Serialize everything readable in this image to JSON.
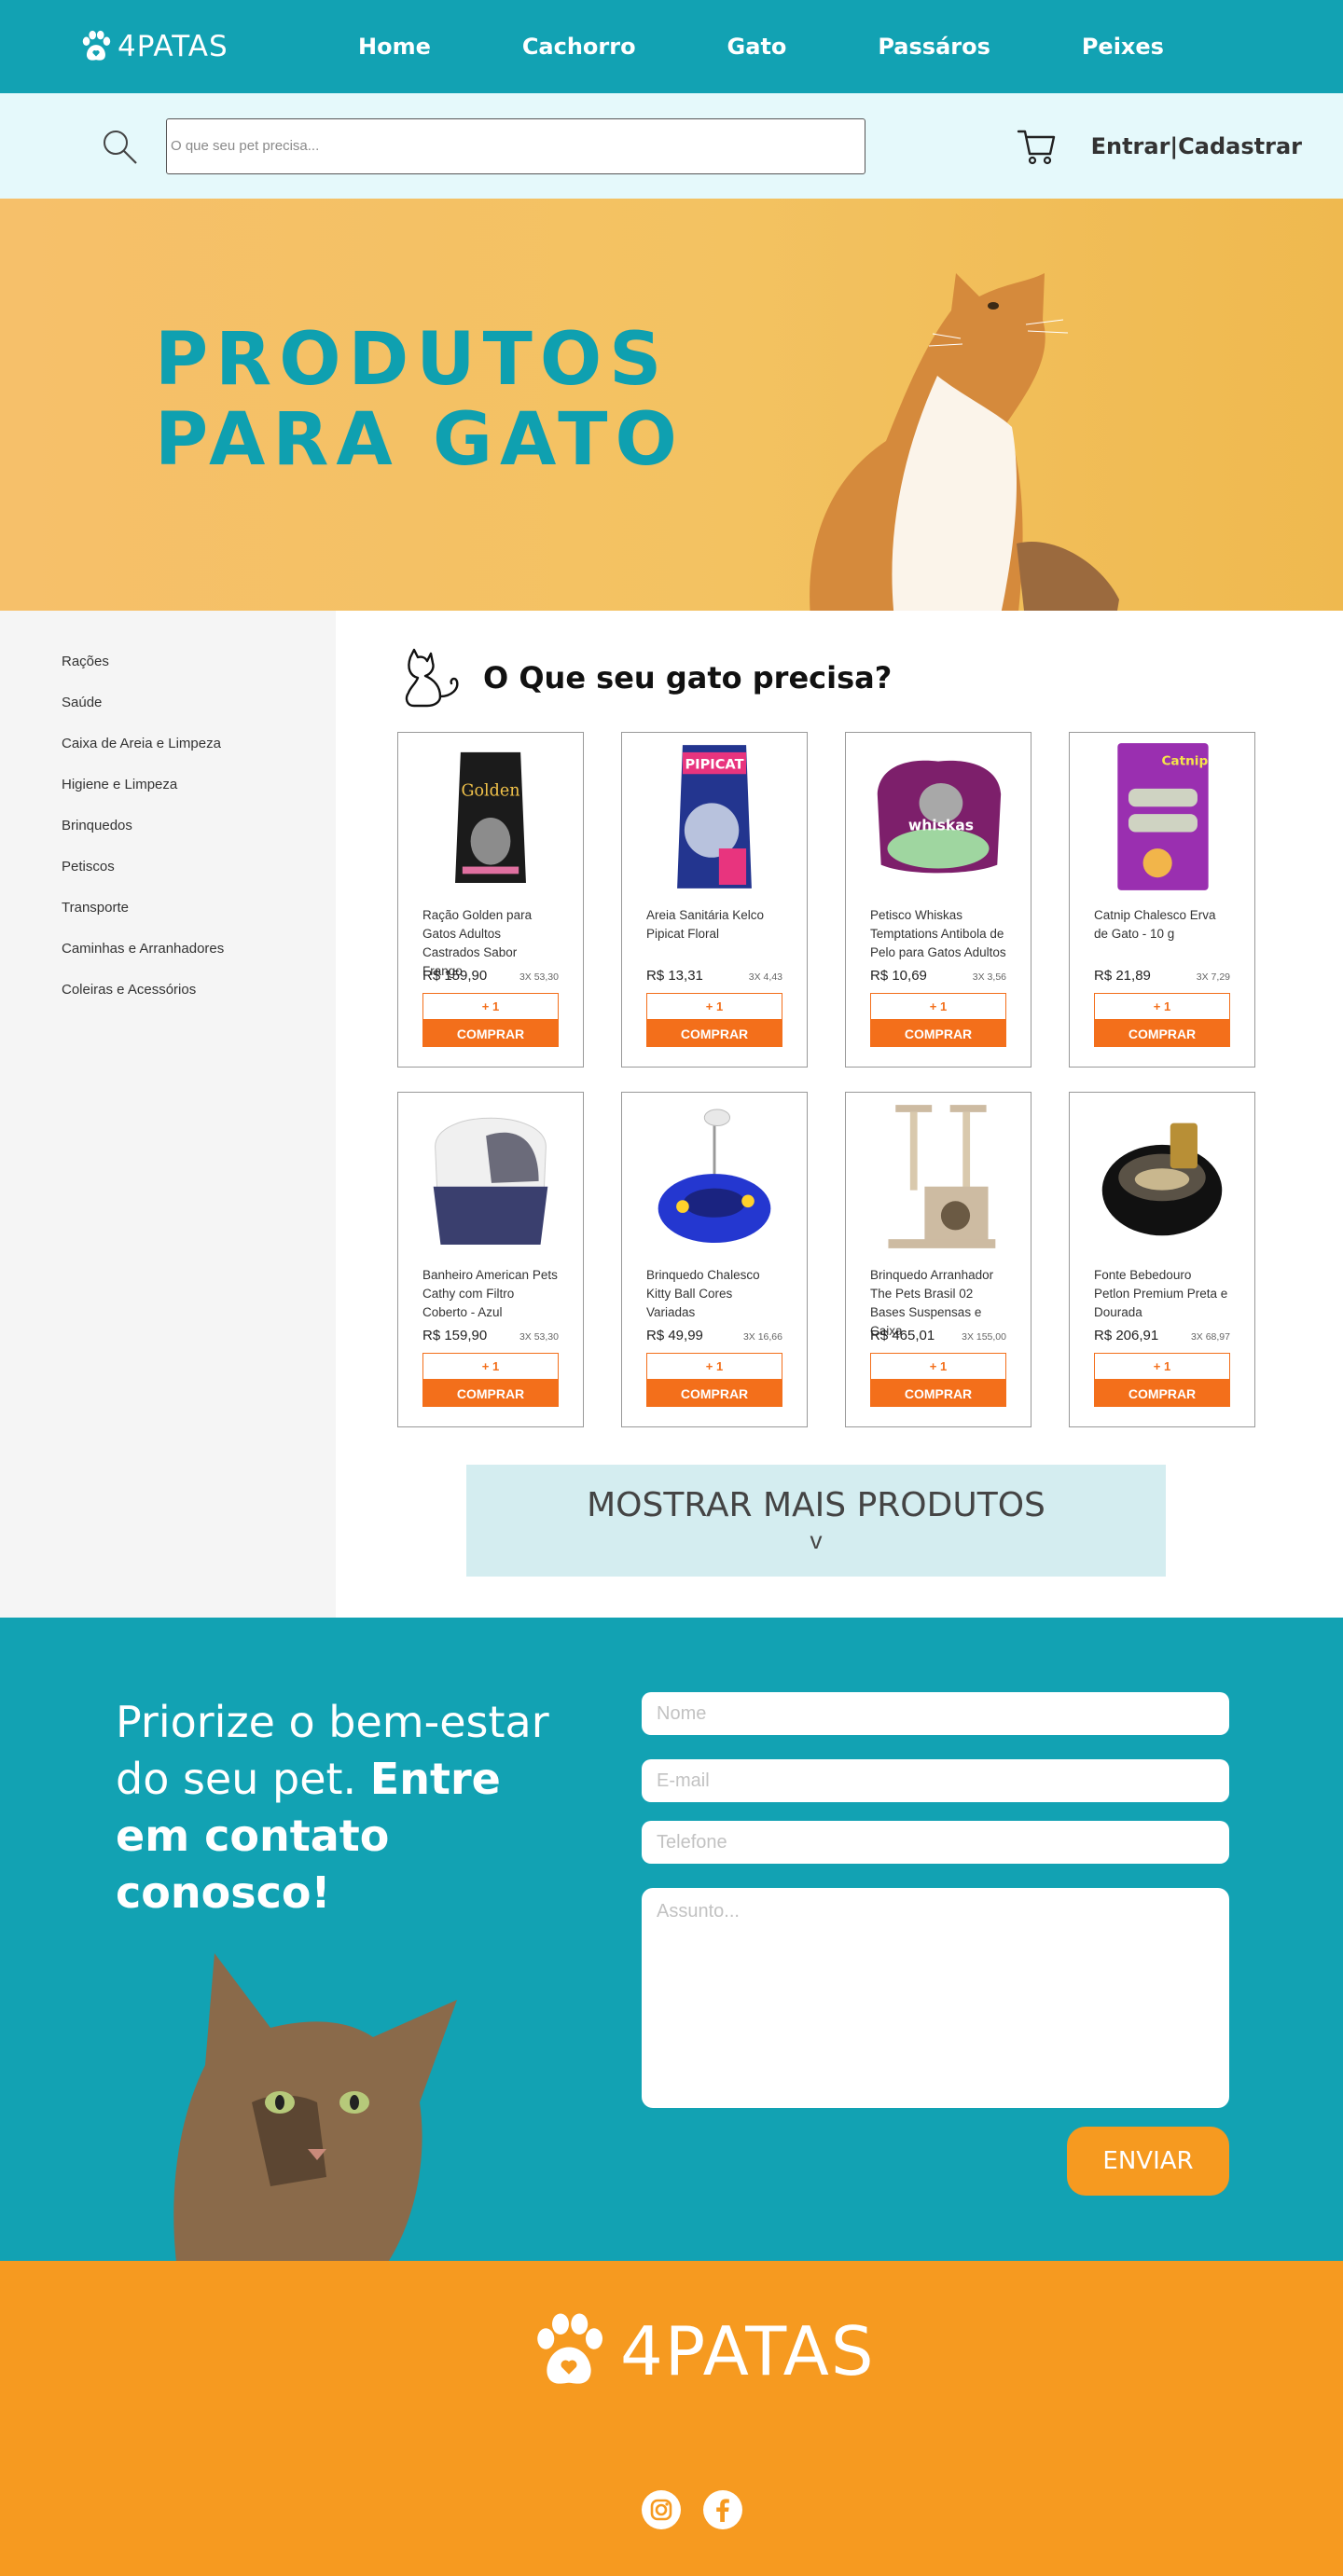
{
  "brand": {
    "name": "4PATAS",
    "colors": {
      "teal": "#12a2b3",
      "orange": "#f36f1b",
      "amber": "#f69a20"
    }
  },
  "nav": {
    "links": [
      "Home",
      "Cachorro",
      "Gato",
      "Passáros",
      "Peixes"
    ]
  },
  "search": {
    "placeholder": "O que seu pet precisa...",
    "login_label": "Entrar|Cadastrar"
  },
  "hero": {
    "title_line1": "PRODUTOS",
    "title_line2": "PARA GATO"
  },
  "sidebar": {
    "items": [
      "Rações",
      "Saúde",
      "Caixa de Areia e Limpeza",
      "Higiene e Limpeza",
      "Brinquedos",
      "Petiscos",
      "Transporte",
      "Caminhas e Arranhadores",
      "Coleiras e Acessórios"
    ]
  },
  "main": {
    "title": "O Que seu gato precisa?"
  },
  "products": [
    {
      "name": "Ração Golden para Gatos Adultos Castrados Sabor Frango",
      "price": "R$ 159,90",
      "installment": "3X 53,30",
      "plus_label": "+ 1",
      "buy_label": "COMPRAR",
      "icon": "food-bag"
    },
    {
      "name": "Areia Sanitária Kelco Pipicat Floral",
      "price": "R$ 13,31",
      "installment": "3X 4,43",
      "plus_label": "+ 1",
      "buy_label": "COMPRAR",
      "icon": "litter-bag"
    },
    {
      "name": "Petisco Whiskas Temptations Antibola de Pelo para Gatos Adultos",
      "price": "R$ 10,69",
      "installment": "3X 3,56",
      "plus_label": "+ 1",
      "buy_label": "COMPRAR",
      "icon": "treat-pouch"
    },
    {
      "name": "Catnip Chalesco Erva de Gato - 10 g",
      "price": "R$ 21,89",
      "installment": "3X 7,29",
      "plus_label": "+ 1",
      "buy_label": "COMPRAR",
      "icon": "catnip-pack"
    },
    {
      "name": "Banheiro American Pets Cathy com Filtro Coberto - Azul",
      "price": "R$ 159,90",
      "installment": "3X 53,30",
      "plus_label": "+ 1",
      "buy_label": "COMPRAR",
      "icon": "litter-box"
    },
    {
      "name": "Brinquedo Chalesco Kitty Ball Cores Variadas",
      "price": "R$ 49,99",
      "installment": "3X 16,66",
      "plus_label": "+ 1",
      "buy_label": "COMPRAR",
      "icon": "ball-toy"
    },
    {
      "name": "Brinquedo Arranhador The Pets Brasil 02 Bases Suspensas e Caixa",
      "price": "R$ 465,01",
      "installment": "3X 155,00",
      "plus_label": "+ 1",
      "buy_label": "COMPRAR",
      "icon": "scratcher"
    },
    {
      "name": "Fonte Bebedouro Petlon Premium Preta e Dourada",
      "price": "R$ 206,91",
      "installment": "3X 68,97",
      "plus_label": "+ 1",
      "buy_label": "COMPRAR",
      "icon": "water-fountain"
    }
  ],
  "more": {
    "label": "MOSTRAR MAIS PRODUTOS",
    "arrow": "v"
  },
  "contact": {
    "line1": "Priorize o bem-estar do seu pet. ",
    "line2_bold": "Entre em contato conosco!",
    "name_placeholder": "Nome",
    "email_placeholder": "E-mail",
    "phone_placeholder": "Telefone",
    "subject_placeholder": "Assunto...",
    "send_label": "ENVIAR"
  },
  "footer": {
    "logo_text": "4PATAS",
    "social": [
      "instagram-icon",
      "facebook-icon"
    ]
  }
}
